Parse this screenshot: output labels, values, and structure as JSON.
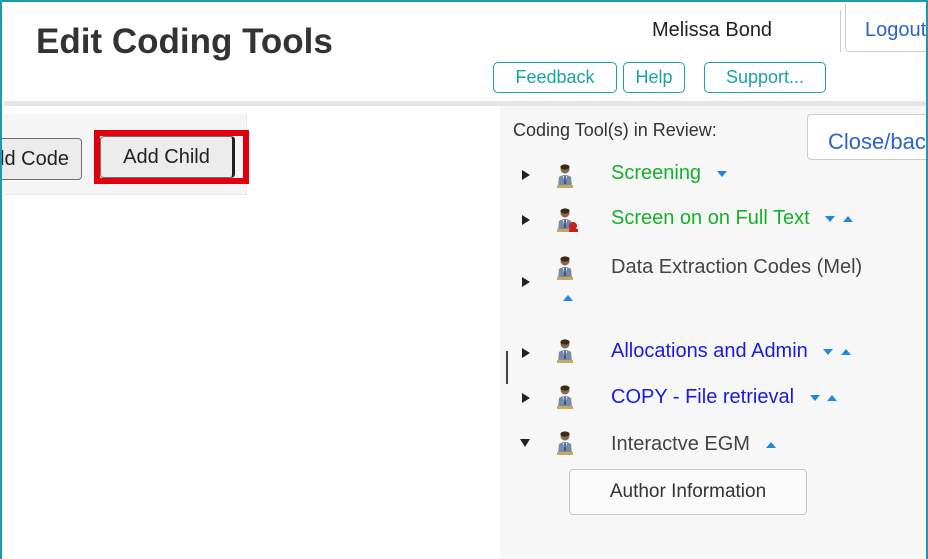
{
  "header": {
    "title": "Edit Coding Tools",
    "user_name": "Melissa Bond",
    "logout_label": "Logout",
    "buttons": {
      "feedback": "Feedback",
      "help": "Help",
      "support": "Support..."
    }
  },
  "toolbar": {
    "add_code_label": "Add Code",
    "add_child_label": "Add Child"
  },
  "review_panel": {
    "label": "Coding Tool(s) in Review:",
    "close_label": "Close/back",
    "tools": [
      {
        "name": "Screening",
        "color": "#16b12a",
        "expanded": false,
        "icon": "person-icon"
      },
      {
        "name": "Screen on on Full Text",
        "color": "#16b12a",
        "expanded": false,
        "icon": "person-edit-icon"
      },
      {
        "name": "Data Extraction Codes (Mel)",
        "color": "#444444",
        "expanded": false,
        "icon": "person-icon"
      },
      {
        "name": "Allocations and Admin",
        "color": "#1a1ae0",
        "expanded": false,
        "icon": "person-icon"
      },
      {
        "name": "COPY - File retrieval",
        "color": "#1a1ae0",
        "expanded": false,
        "icon": "person-icon"
      },
      {
        "name": "Interactve EGM",
        "color": "#444444",
        "expanded": true,
        "icon": "person-icon"
      }
    ],
    "child_code_label": "Author Information"
  },
  "colors": {
    "highlight": "#e0000d",
    "frame": "#1a9bb5",
    "accent": "#1aa3a3",
    "link": "#2e63c7"
  }
}
